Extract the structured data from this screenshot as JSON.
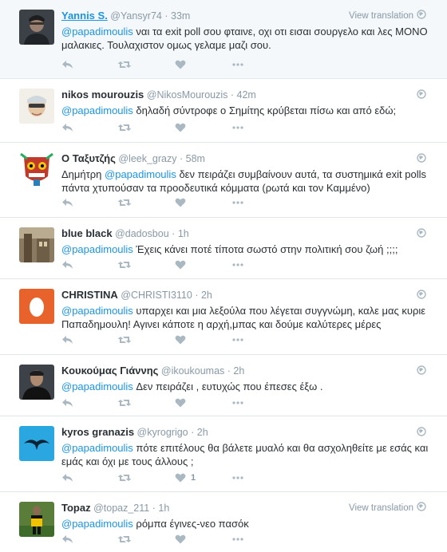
{
  "tweets": [
    {
      "name": "Yannis S.",
      "handle": "@Yansyr74",
      "time": "33m",
      "mention": "@papadimoulis",
      "text": " ναι τα exit poll σου φταινε, οχι οτι εισαι σουργελο και λες ΜΟΝΟ μαλακιες. Τουλαχιστον ομως γελαμε μαζι σου.",
      "top_right": "View translation",
      "likes": ""
    },
    {
      "name": "nikos mourouzis",
      "handle": "@NikosMourouzis",
      "time": "42m",
      "mention": "@papadimoulis",
      "text": " δηλαδή σύντροφε ο Σημίτης κρύβεται πίσω και από εδώ;",
      "likes": ""
    },
    {
      "name": "Ο Ταξυτζής",
      "handle": "@leek_grazy",
      "time": "58m",
      "prefix": "Δημήτρη ",
      "mention": "@papadimoulis",
      "text": " δεν πειράζει συμβαίνουν αυτά, τα συστημικά exit polls πάντα χτυπούσαν τα προοδευτικά κόμματα (ρωτά και τον Καμμένο)",
      "likes": ""
    },
    {
      "name": "blue black",
      "handle": "@dadosbou",
      "time": "1h",
      "mention": "@papadimoulis",
      "text": " Έχεις κάνει ποτέ τίποτα σωστό στην πολιτική σου ζωή ;;;;",
      "likes": ""
    },
    {
      "name": "CHRISTINA",
      "handle": "@CHRISTI3110",
      "time": "2h",
      "mention": "@papadimoulis",
      "text": " υπαρχει και μια λεξούλα που λέγεται συγγνώμη, καλε μας κυριε Παπαδημουλη! Αγινει κάποτε η αρχή,μπας και δούμε καλύτερες μέρες",
      "likes": ""
    },
    {
      "name": "Κουκούμας Γιάννης",
      "handle": "@ikoukoumas",
      "time": "2h",
      "mention": "@papadimoulis",
      "text": "  Δεν πειράζει , ευτυχώς που έπεσες έξω .",
      "likes": ""
    },
    {
      "name": "kyros granazis",
      "handle": "@kyrogrigo",
      "time": "2h",
      "mention": "@papadimoulis",
      "text": " πότε επιτέλους θα βάλετε μυαλό και θα ασχοληθείτε με εσάς και εμάς και όχι με τους άλλους ;",
      "likes": "1"
    },
    {
      "name": "Topaz",
      "handle": "@topaz_211",
      "time": "1h",
      "mention": "@papadimoulis",
      "text": " ρόμπα έγινες-νεο πασόκ",
      "top_right": "View translation",
      "likes": ""
    }
  ],
  "colors": {
    "link": "#1b95e0",
    "muted": "#8899a6",
    "icon": "#aab8c2",
    "text": "#292f33",
    "highlight_bg": "#f5f8fa"
  },
  "icons": [
    "reply-icon",
    "retweet-icon",
    "like-icon",
    "more-icon",
    "globe-icon"
  ]
}
